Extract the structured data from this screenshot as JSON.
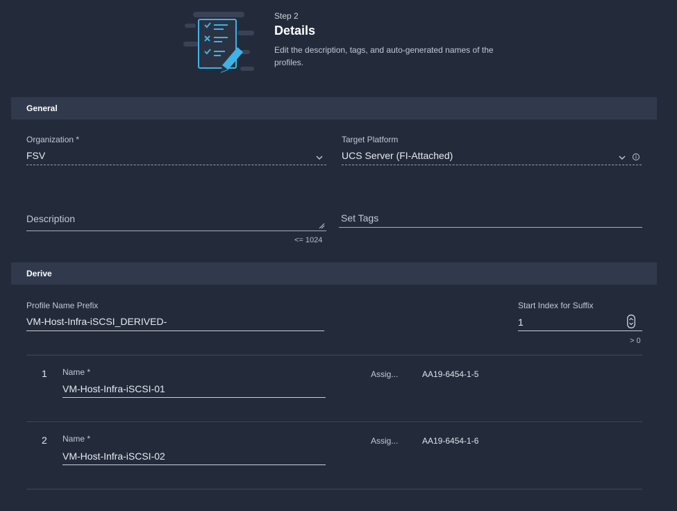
{
  "header": {
    "step_label": "Step 2",
    "title": "Details",
    "description": "Edit the description, tags, and auto-generated names of the profiles."
  },
  "general": {
    "section_title": "General",
    "organization": {
      "label": "Organization *",
      "value": "FSV"
    },
    "target_platform": {
      "label": "Target Platform",
      "value": "UCS Server (FI-Attached)"
    },
    "description": {
      "placeholder": "Description",
      "limit_hint": "<= 1024"
    },
    "tags": {
      "placeholder": "Set Tags"
    }
  },
  "derive": {
    "section_title": "Derive",
    "prefix": {
      "label": "Profile Name Prefix",
      "value": "VM-Host-Infra-iSCSI_DERIVED-"
    },
    "start_index": {
      "label": "Start Index for Suffix",
      "value": "1",
      "hint": "> 0"
    },
    "profiles": [
      {
        "index": "1",
        "name_label": "Name *",
        "name_value": "VM-Host-Infra-iSCSI-01",
        "assign_label": "Assig...",
        "assign_value": "AA19-6454-1-5"
      },
      {
        "index": "2",
        "name_label": "Name *",
        "name_value": "VM-Host-Infra-iSCSI-02",
        "assign_label": "Assig...",
        "assign_value": "AA19-6454-1-6"
      }
    ]
  },
  "colors": {
    "background": "#232b3b",
    "section_bar": "#313a4c",
    "icon_accent": "#3fb3e6"
  },
  "icons": [
    "checklist-pencil-icon",
    "chevron-down-icon",
    "info-icon",
    "resize-handle-icon",
    "stepper-icon"
  ]
}
